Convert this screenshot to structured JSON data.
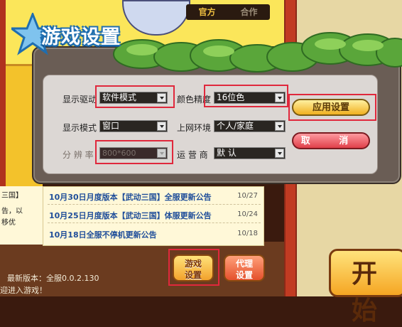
{
  "header": {
    "tab_official": "官方",
    "tab_partner": "合作"
  },
  "dialog": {
    "title": "游戏设置",
    "fields": {
      "display_driver": {
        "label": "显示驱动",
        "value": "软件模式"
      },
      "display_mode": {
        "label": "显示模式",
        "value": "窗口"
      },
      "resolution": {
        "label": "分 辨 率",
        "value": "800*600"
      },
      "color_depth": {
        "label": "颜色精度",
        "value": "16位色"
      },
      "network": {
        "label": "上网环境",
        "value": "个人/家庭"
      },
      "carrier": {
        "label": "运 营 商",
        "value": "默  认"
      }
    },
    "apply_label": "应用设置",
    "cancel_label": "取 消"
  },
  "news": [
    {
      "title": "10月30日月度版本【武动三国】全服更新公告",
      "date": "10/27"
    },
    {
      "title": "10月25日月度版本【武动三国】体服更新公告",
      "date": "10/24"
    },
    {
      "title": "10月18日全服不停机更新公告",
      "date": "10/18"
    }
  ],
  "left_snippet": [
    "三国】",
    "告，以",
    "移优"
  ],
  "footer": {
    "game_settings_label": "游戏\n设置",
    "agent_settings_label": "代理\n设置",
    "version": "最新版本：全服0.0.2.130",
    "welcome": "迎进入游戏！",
    "start_label": "开始"
  },
  "colors": {
    "highlight_frame": "#e0283c",
    "accent_gold": "#f2a22c"
  }
}
